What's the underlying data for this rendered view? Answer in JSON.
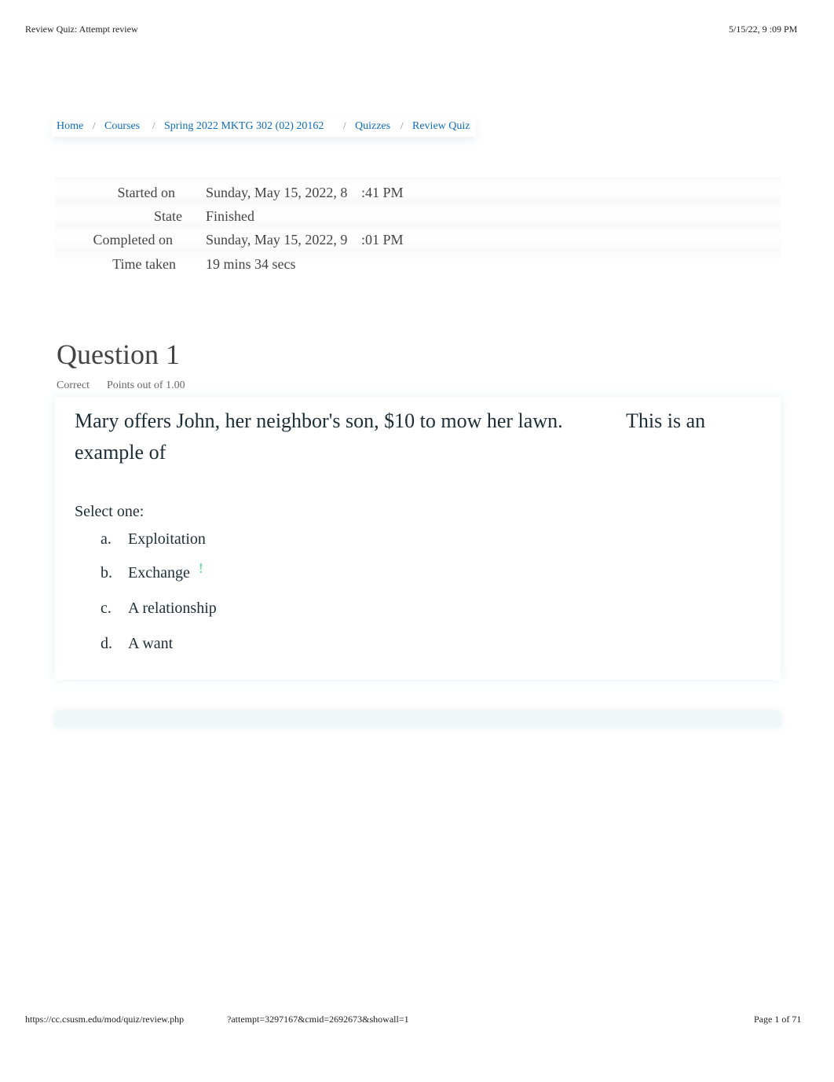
{
  "print_header": {
    "title": "Review Quiz: Attempt review",
    "datetime": "5/15/22, 9  :09 PM"
  },
  "breadcrumb": [
    {
      "label": "Home"
    },
    {
      "label": "Courses"
    },
    {
      "label": "Spring 2022 MKTG 302 (02) 20162"
    },
    {
      "label": "Quizzes"
    },
    {
      "label": "Review Quiz"
    }
  ],
  "breadcrumb_separator": "/",
  "summary": [
    {
      "label": "Started on",
      "value": "Sunday, May 15, 2022, 8",
      "value2": ":41 PM"
    },
    {
      "label": "State",
      "value": "Finished",
      "value2": ""
    },
    {
      "label": "Completed on",
      "value": "Sunday, May 15, 2022, 9",
      "value2": ":01 PM"
    },
    {
      "label": "Time taken",
      "value": "19 mins 34 secs",
      "value2": ""
    }
  ],
  "question": {
    "title": "Question 1",
    "status": "Correct",
    "points": "Points out of 1.00",
    "text_line1": "Mary offers John, her neighbor's son, $10 to mow her lawn.",
    "text_line1b": "This is an",
    "text_line2": "example of",
    "prompt": "Select one:",
    "options": [
      {
        "letter": "a.",
        "label": "Exploitation"
      },
      {
        "letter": "b.",
        "label": "Exchange",
        "correct_mark": "!"
      },
      {
        "letter": "c.",
        "label": "A relationship"
      },
      {
        "letter": "d.",
        "label": "A want"
      }
    ],
    "correct_color": "#3ee878"
  },
  "print_footer": {
    "url": "https://cc.csusm.edu/mod/quiz/review.php",
    "query": "?attempt=3297167&cmid=2692673&showall=1",
    "page": "Page 1 of 71"
  },
  "colors": {
    "link": "#0f6cbf"
  }
}
